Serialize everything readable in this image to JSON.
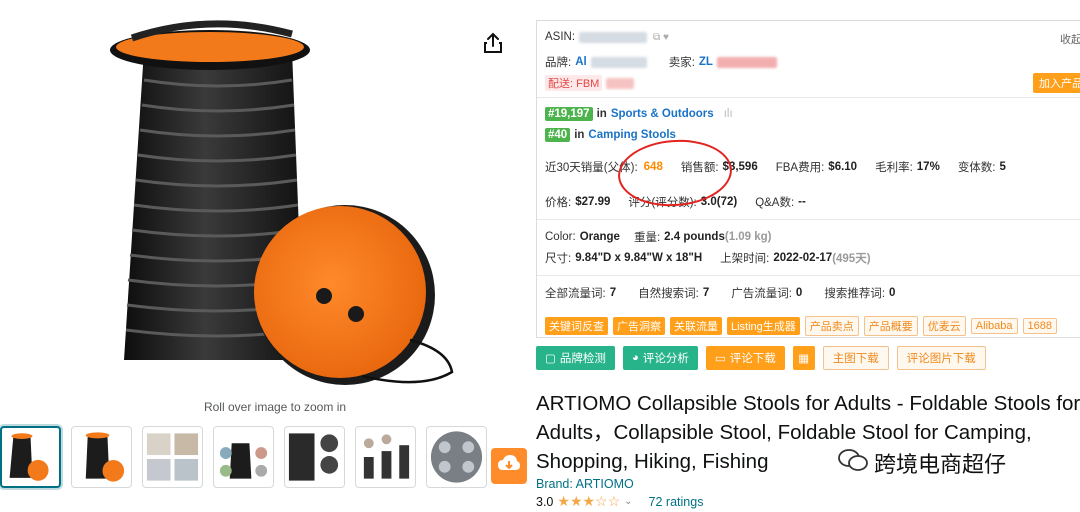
{
  "media": {
    "zoom_hint": "Roll over image to zoom in",
    "thumbnail_count": 7
  },
  "panel": {
    "asin_label": "ASIN:",
    "collect_label": "收起",
    "brand_label": "品牌:",
    "brand_value": "Al",
    "seller_label": "卖家:",
    "seller_value": "ZL",
    "delivery_label": "配送: FBM",
    "add_product_label": "加入产品",
    "rank1": {
      "rank": "#19,197",
      "in": "in",
      "category": "Sports & Outdoors"
    },
    "rank2": {
      "rank": "#40",
      "in": "in",
      "category": "Camping Stools"
    },
    "sales_label": "近30天销量(父体):",
    "sales_value": "648",
    "revenue_label": "销售额:",
    "revenue_value": "$3,596",
    "fba_label": "FBA费用:",
    "fba_value": "$6.10",
    "margin_label": "毛利率:",
    "margin_value": "17%",
    "variants_label": "变体数:",
    "variants_value": "5",
    "price_label": "价格:",
    "price_value": "$27.99",
    "reviews_label": "评分(评分数):",
    "reviews_value": "3.0(72)",
    "qa_label": "Q&A数:",
    "qa_value": "--",
    "color_label": "Color:",
    "color_value": "Orange",
    "weight_label": "重量:",
    "weight_value": "2.4 pounds",
    "weight_kg": "(1.09 kg)",
    "size_label": "尺寸:",
    "size_value": "9.84\"D x 9.84\"W x 18\"H",
    "listed_label": "上架时间:",
    "listed_value": "2022-02-17",
    "listed_days": "(495天)",
    "traffic_total_label": "全部流量词:",
    "traffic_total_value": "7",
    "organic_label": "自然搜索词:",
    "organic_value": "7",
    "ad_label": "广告流量词:",
    "ad_value": "0",
    "rec_label": "搜索推荐词:",
    "rec_value": "0",
    "tags_solid": [
      "关键词反查",
      "广告洞察",
      "关联流量",
      "Listing生成器"
    ],
    "tags_outline": [
      "产品卖点",
      "产品概要",
      "优麦云",
      "Alibaba",
      "1688"
    ]
  },
  "actions": {
    "brand_check": "品牌检测",
    "review_analysis": "评论分析",
    "review_download": "评论下载",
    "main_image_download": "主图下载",
    "review_image_download": "评论图片下载"
  },
  "product": {
    "title": "ARTIOMO Collapsible Stools for Adults - Foldable Stools for Adults，Collapsible Stool, Foldable Stool for Camping, Shopping, Hiking, Fishing",
    "brand": "Brand: ARTIOMO",
    "rating_value": "3.0",
    "stars": "★★★☆☆",
    "ratings": "72 ratings"
  },
  "watermark": "跨境电商超仔",
  "colors": {
    "accent_orange": "#ff9f1a",
    "rank_green": "#4db34d",
    "link_blue": "#1a73c7",
    "highlight_red": "#e3231f",
    "product_orange": "#f27a1a"
  }
}
